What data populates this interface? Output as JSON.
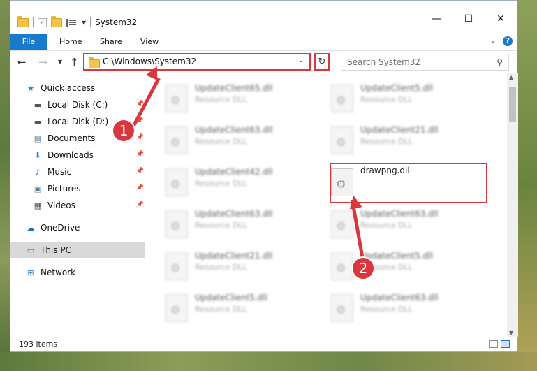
{
  "window": {
    "title": "System32",
    "controls": {
      "minimize": "—",
      "maximize": "☐",
      "close": "✕"
    }
  },
  "ribbon": {
    "tabs": [
      "File",
      "Home",
      "Share",
      "View"
    ],
    "help": "?"
  },
  "nav": {
    "address": "C:\\Windows\\System32",
    "search_placeholder": "Search System32"
  },
  "sidebar": {
    "items": [
      {
        "label": "Quick access",
        "icon": "star-icon",
        "pinned": false
      },
      {
        "label": "Local Disk (C:)",
        "icon": "drive-icon",
        "pinned": true
      },
      {
        "label": "Local Disk (D:)",
        "icon": "drive-icon",
        "pinned": true
      },
      {
        "label": "Documents",
        "icon": "documents-icon",
        "pinned": true
      },
      {
        "label": "Downloads",
        "icon": "download-icon",
        "pinned": true
      },
      {
        "label": "Music",
        "icon": "music-icon",
        "pinned": true
      },
      {
        "label": "Pictures",
        "icon": "pictures-icon",
        "pinned": true
      },
      {
        "label": "Videos",
        "icon": "videos-icon",
        "pinned": true
      },
      {
        "label": "OneDrive",
        "icon": "cloud-icon",
        "pinned": false
      },
      {
        "label": "This PC",
        "icon": "computer-icon",
        "pinned": false
      },
      {
        "label": "Network",
        "icon": "network-icon",
        "pinned": false
      }
    ]
  },
  "files": {
    "col1": [
      {
        "name": "UpdateClient65.dll",
        "type": "Resource DLL"
      },
      {
        "name": "UpdateClient63.dll",
        "type": "Resource DLL"
      },
      {
        "name": "UpdateClient42.dll",
        "type": "Resource DLL"
      },
      {
        "name": "UpdateClient63.dll",
        "type": "Resource DLL"
      },
      {
        "name": "UpdateClient21.dll",
        "type": "Resource DLL"
      },
      {
        "name": "UpdateClient5.dll",
        "type": "Resource DLL"
      }
    ],
    "col2": [
      {
        "name": "UpdateClient5.dll",
        "type": "Resource DLL"
      },
      {
        "name": "UpdateClient21.dll",
        "type": "Resource DLL"
      },
      {
        "name": "drawpng.dll",
        "type": ""
      },
      {
        "name": "UpdateClient63.dll",
        "type": "Resource DLL"
      },
      {
        "name": "UpdateClient5.dll",
        "type": "Resource DLL"
      },
      {
        "name": "UpdateClient63.dll",
        "type": "Resource DLL"
      }
    ]
  },
  "status": {
    "items": "193 items"
  },
  "annotations": {
    "callout1": "1",
    "callout2": "2",
    "color": "#d9363e"
  }
}
